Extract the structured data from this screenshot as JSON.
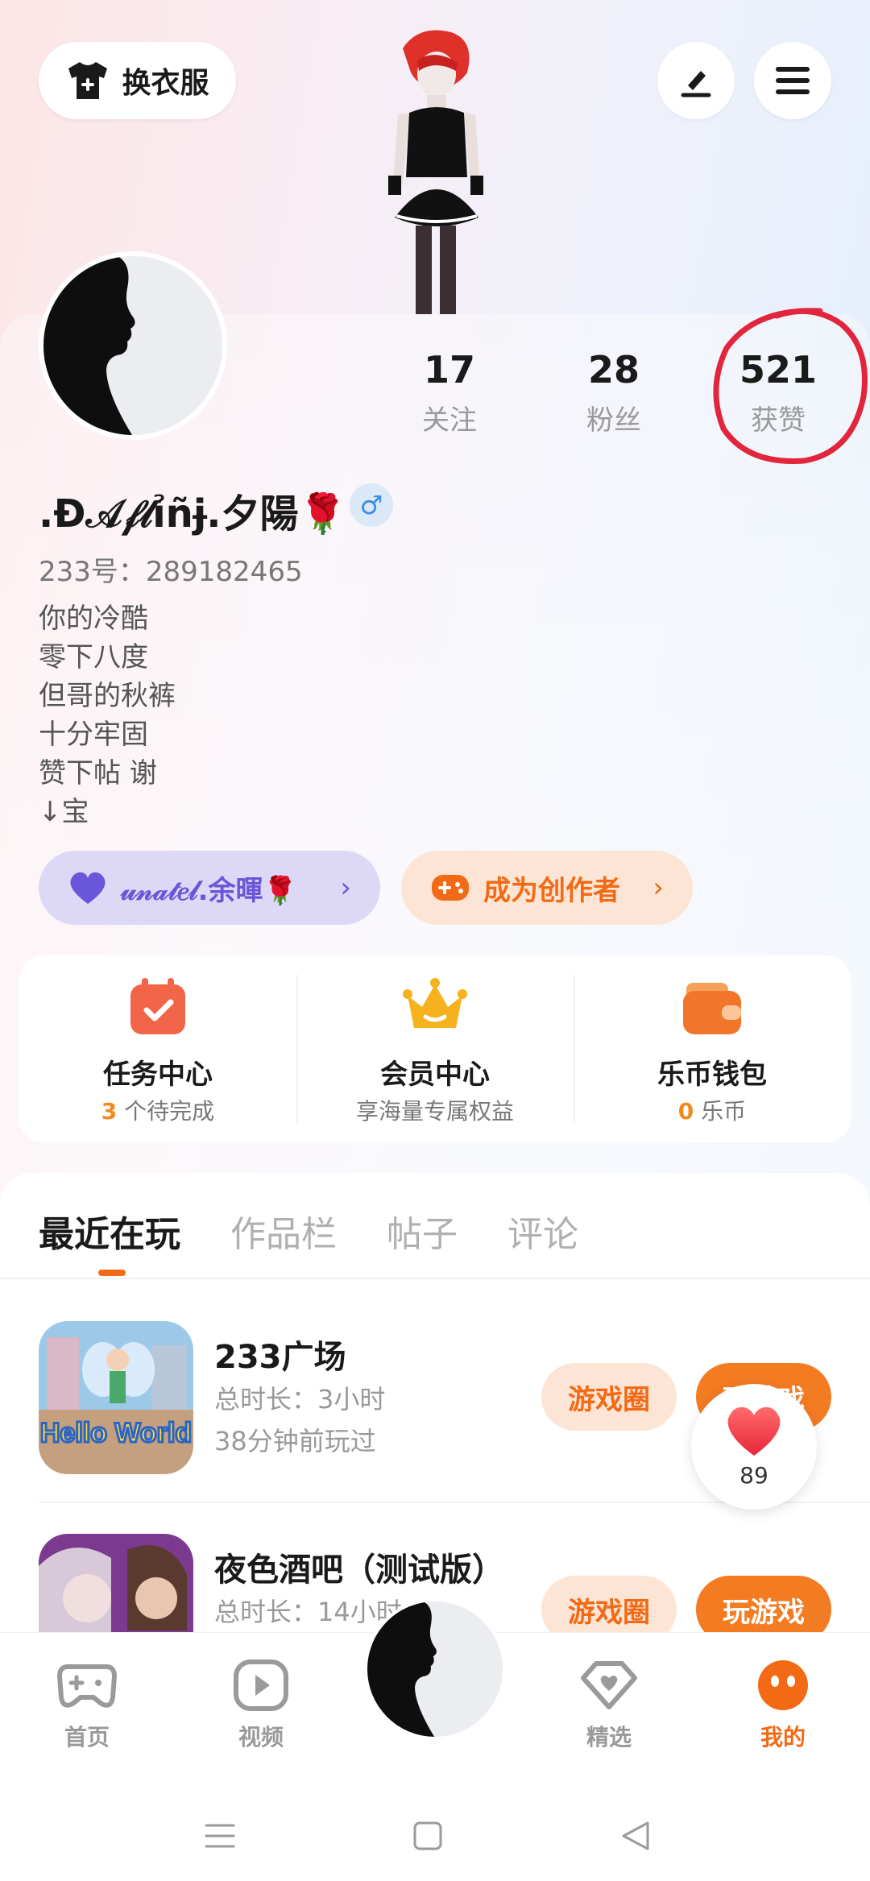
{
  "header": {
    "outfit_button": "换衣服"
  },
  "profile": {
    "username": ".Ɖ𝒜𝒻𝓁ỉñɉ.夕陽🌹",
    "gender_symbol": "♂",
    "id_label": "233号：289182465",
    "stats": [
      {
        "value": "17",
        "label": "关注"
      },
      {
        "value": "28",
        "label": "粉丝"
      },
      {
        "value": "521",
        "label": "获赞"
      }
    ],
    "bio": [
      "你的冷酷",
      "零下八度",
      "但哥的秋裤",
      "十分牢固",
      "赞下帖 谢",
      "↓宝"
    ]
  },
  "pills": {
    "partner": "𝓊𝓃𝒶𝓉𝑒𝓁.余暉🌹",
    "creator": "成为创作者"
  },
  "cards": [
    {
      "title": "任务中心",
      "highlight": "3",
      "sub": " 个待完成"
    },
    {
      "title": "会员中心",
      "highlight": "",
      "sub": "享海量专属权益"
    },
    {
      "title": "乐币钱包",
      "highlight": "0",
      "sub": " 乐币"
    }
  ],
  "tabs": [
    "最近在玩",
    "作品栏",
    "帖子",
    "评论"
  ],
  "games": [
    {
      "name": "233广场",
      "duration": "总时长：3小时",
      "last_played": "38分钟前玩过",
      "thumb_text": "Hello World"
    },
    {
      "name": "夜色酒吧（测试版）",
      "duration": "总时长：14小时",
      "last_played": ""
    }
  ],
  "game_buttons": {
    "circle": "游戏圈",
    "play": "玩游戏"
  },
  "like_count": "89",
  "bottom_nav": [
    {
      "label": "首页",
      "icon": "gamepad-icon"
    },
    {
      "label": "视频",
      "icon": "play-icon"
    },
    {
      "label": "精选",
      "icon": "heart-diamond-icon"
    },
    {
      "label": "我的",
      "icon": "face-icon"
    }
  ],
  "colors": {
    "accent": "#f26a15",
    "partner": "#6a56d8"
  }
}
